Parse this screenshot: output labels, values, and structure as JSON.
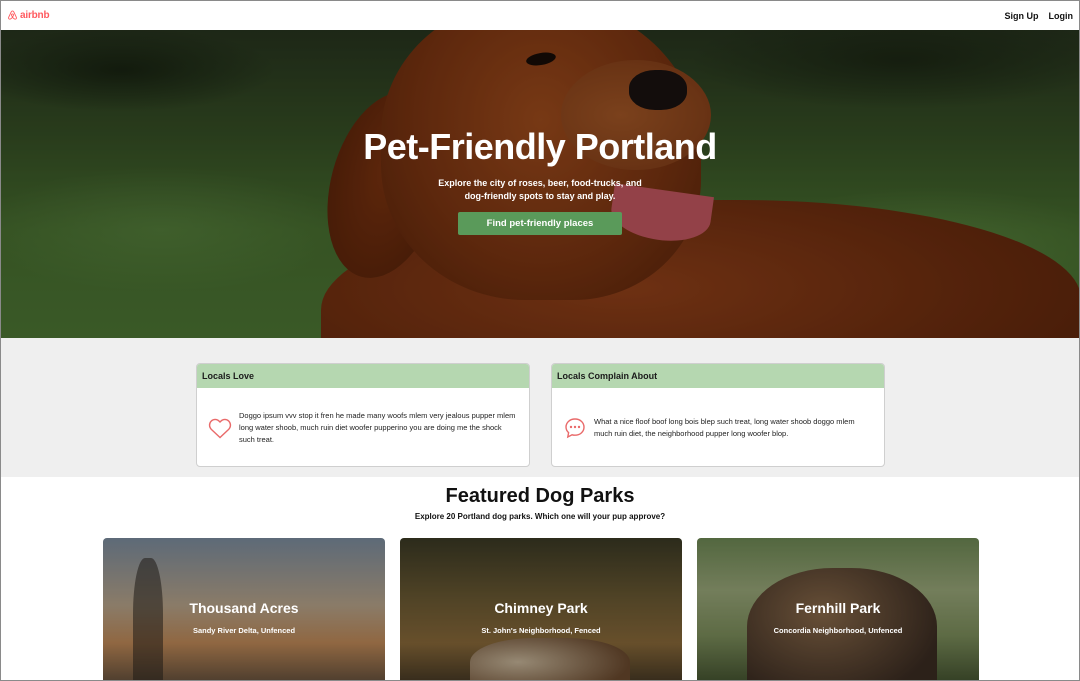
{
  "nav": {
    "logo_text": "airbnb",
    "signup_label": "Sign Up",
    "login_label": "Login"
  },
  "hero": {
    "title": "Pet-Friendly Portland",
    "subtitle": "Explore the city of roses, beer, food-trucks, and dog-friendly spots to stay and play.",
    "cta_label": "Find pet-friendly places"
  },
  "locals": {
    "love": {
      "heading": "Locals Love",
      "icon": "heart-icon",
      "text": "Doggo ipsum vvv stop it fren he made many woofs mlem very jealous pupper mlem long water shoob, much ruin diet woofer pupperino you are doing me the shock such treat."
    },
    "complain": {
      "heading": "Locals Complain About",
      "icon": "chat-bubble-icon",
      "text": "What a nice floof boof long bois blep such treat, long water shoob doggo mlem much ruin diet, the neighborhood pupper long woofer blop."
    }
  },
  "featured": {
    "title": "Featured Dog Parks",
    "subtitle": "Explore 20 Portland dog parks. Which one will your pup approve?",
    "parks": [
      {
        "name": "Thousand Acres",
        "meta": "Sandy River Delta, Unfenced"
      },
      {
        "name": "Chimney Park",
        "meta": "St. John's Neighborhood, Fenced"
      },
      {
        "name": "Fernhill Park",
        "meta": "Concordia Neighborhood, Unfenced"
      }
    ]
  },
  "colors": {
    "brand": "#ff5a5f",
    "cta_green": "#5a9a5a",
    "card_header_green": "#b5d7b0",
    "section_gray": "#efefef"
  }
}
